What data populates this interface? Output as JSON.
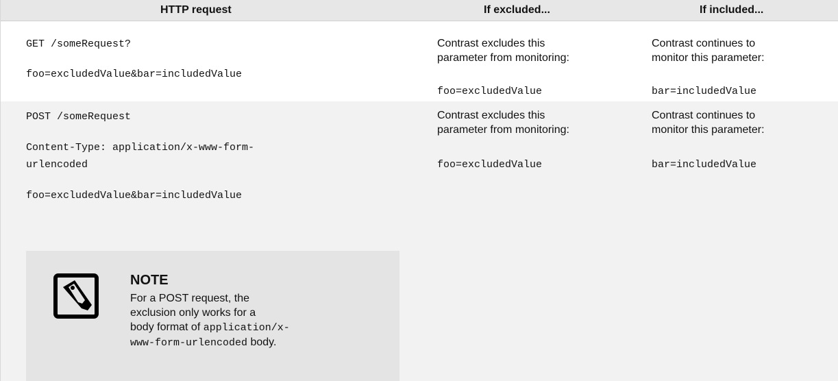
{
  "table": {
    "headers": [
      "HTTP request",
      "If excluded...",
      "If included..."
    ],
    "rows": [
      {
        "request_lines": [
          "GET /someRequest?",
          "foo=excludedValue&bar=includedValue"
        ],
        "excluded_text_1": "Contrast excludes this",
        "excluded_text_2": "parameter from monitoring:",
        "excluded_code": "foo=excludedValue",
        "included_text_1": "Contrast continues to",
        "included_text_2": "monitor this parameter:",
        "included_code": "bar=includedValue"
      },
      {
        "request_lines": [
          "POST /someRequest",
          "Content-Type: application/x-www-form-",
          "urlencoded",
          "foo=excludedValue&bar=includedValue"
        ],
        "excluded_text_1": "Contrast excludes this",
        "excluded_text_2": "parameter from monitoring:",
        "excluded_code": "foo=excludedValue",
        "included_text_1": "Contrast continues to",
        "included_text_2": "monitor this parameter:",
        "included_code": "bar=includedValue"
      }
    ]
  },
  "note": {
    "icon": "note-icon",
    "title": "NOTE",
    "line1": "For a POST request, the",
    "line2": "exclusion only works for a",
    "line3_prefix": "body format of ",
    "line3_code": "application/x-",
    "line4_code": "www-form-urlencoded",
    "line4_suffix": " body."
  },
  "colors": {
    "header_bg": "#e7e7e7",
    "row_alt_bg": "#f2f2f2",
    "note_bg": "#e4e4e4"
  }
}
